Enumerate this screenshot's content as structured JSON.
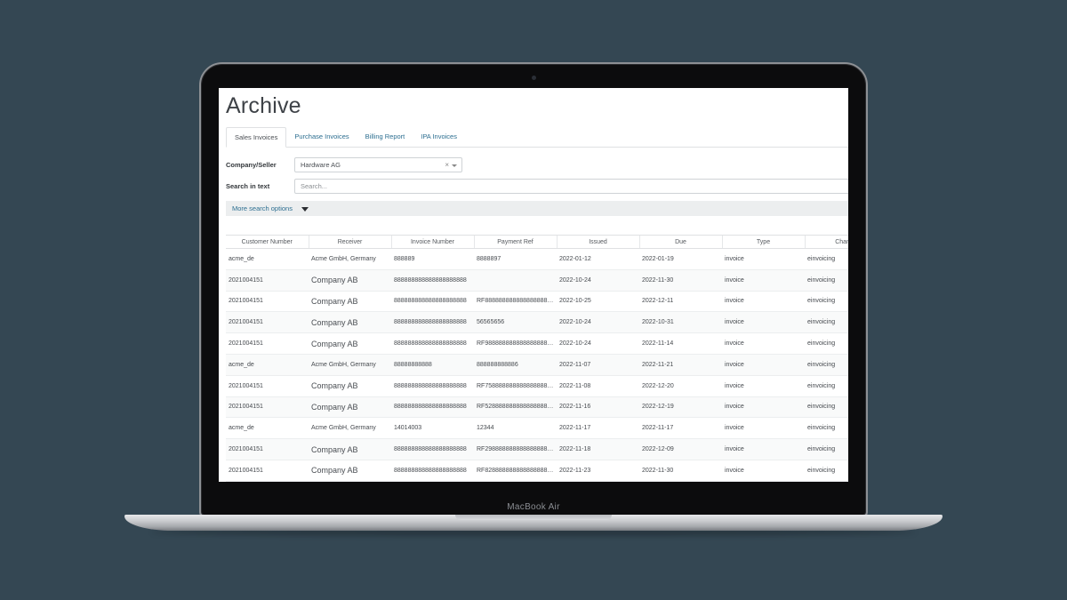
{
  "device": {
    "label": "MacBook Air"
  },
  "page": {
    "title": "Archive"
  },
  "tabs": [
    {
      "label": "Sales Invoices",
      "active": true
    },
    {
      "label": "Purchase Invoices",
      "active": false
    },
    {
      "label": "Billing Report",
      "active": false
    },
    {
      "label": "IPA Invoices",
      "active": false
    }
  ],
  "filters": {
    "company_label": "Company/Seller",
    "company_value": "Hardware AG",
    "company_clear": "×",
    "search_label": "Search in text",
    "search_placeholder": "Search...",
    "more_options": "More search options"
  },
  "table": {
    "columns": [
      "Customer Number",
      "Receiver",
      "Invoice Number",
      "Payment Ref",
      "Issued",
      "Due",
      "Type",
      "Channel"
    ],
    "rows": [
      [
        "acme_de",
        "Acme GmbH, Germany",
        "888889",
        "8888897",
        "2022-01-12",
        "2022-01-19",
        "invoice",
        "einvoicing"
      ],
      [
        "2021004151",
        "Company AB",
        "888888888888888888888",
        "",
        "2022-10-24",
        "2022-11-30",
        "invoice",
        "einvoicing"
      ],
      [
        "2021004151",
        "Company AB",
        "888888888888888888888",
        "RF888888888888888888888",
        "2022-10-25",
        "2022-12-11",
        "invoice",
        "einvoicing"
      ],
      [
        "2021004151",
        "Company AB",
        "888888888888888888888",
        "56565656",
        "2022-10-24",
        "2022-10-31",
        "invoice",
        "einvoicing"
      ],
      [
        "2021004151",
        "Company AB",
        "888888888888888888888",
        "RF988888888888888888888",
        "2022-10-24",
        "2022-11-14",
        "invoice",
        "einvoicing"
      ],
      [
        "acme_de",
        "Acme GmbH, Germany",
        "88888888888",
        "888888888886",
        "2022-11-07",
        "2022-11-21",
        "invoice",
        "einvoicing"
      ],
      [
        "2021004151",
        "Company AB",
        "888888888888888888888",
        "RF758888888888888888888",
        "2022-11-08",
        "2022-12-20",
        "invoice",
        "einvoicing"
      ],
      [
        "2021004151",
        "Company AB",
        "888888888888888888888",
        "RF528888888888888888888",
        "2022-11-16",
        "2022-12-19",
        "invoice",
        "einvoicing"
      ],
      [
        "acme_de",
        "Acme GmbH, Germany",
        "14014003",
        "12344",
        "2022-11-17",
        "2022-11-17",
        "invoice",
        "einvoicing"
      ],
      [
        "2021004151",
        "Company AB",
        "888888888888888888888",
        "RF298888888888888888888",
        "2022-11-18",
        "2022-12-09",
        "invoice",
        "einvoicing"
      ],
      [
        "2021004151",
        "Company AB",
        "888888888888888888888",
        "RF828888888888888888888",
        "2022-11-23",
        "2022-11-30",
        "invoice",
        "einvoicing"
      ]
    ]
  }
}
